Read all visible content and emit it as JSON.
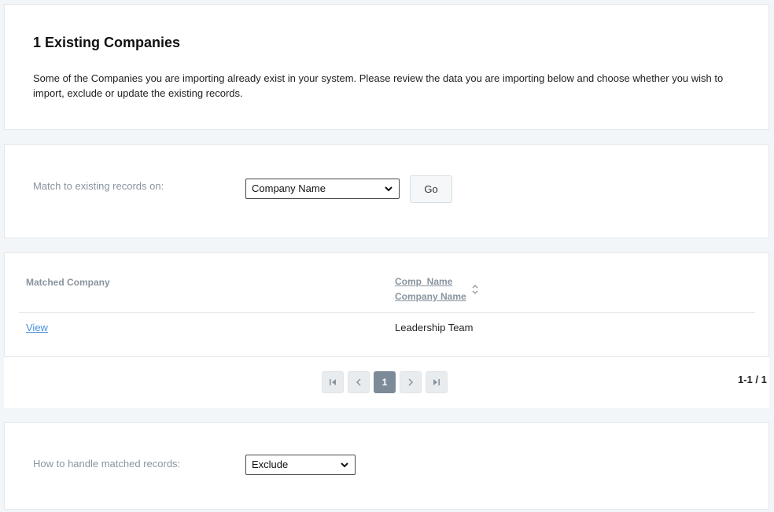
{
  "intro": {
    "title": "1 Existing Companies",
    "description": "Some of the Companies you are importing already exist in your system. Please review the data you are importing below and choose whether you wish to import, exclude or update the existing records."
  },
  "match": {
    "label": "Match to existing records on:",
    "selected": "Company Name",
    "go_label": "Go"
  },
  "table": {
    "col1_header": "Matched Company",
    "col2_header_line1": "Comp_Name",
    "col2_header_line2": "Company Name",
    "rows": [
      {
        "link": "View",
        "company_name": "Leadership Team"
      }
    ]
  },
  "pagination": {
    "current_page": "1",
    "range": "1-1 / 1"
  },
  "handle": {
    "label": "How to handle matched records:",
    "selected": "Exclude"
  },
  "icons": {
    "select_arrow": "chevron-down-icon",
    "sort": "sort-icon",
    "first": "first-page-icon",
    "prev": "prev-page-icon",
    "next": "next-page-icon",
    "last": "last-page-icon"
  }
}
